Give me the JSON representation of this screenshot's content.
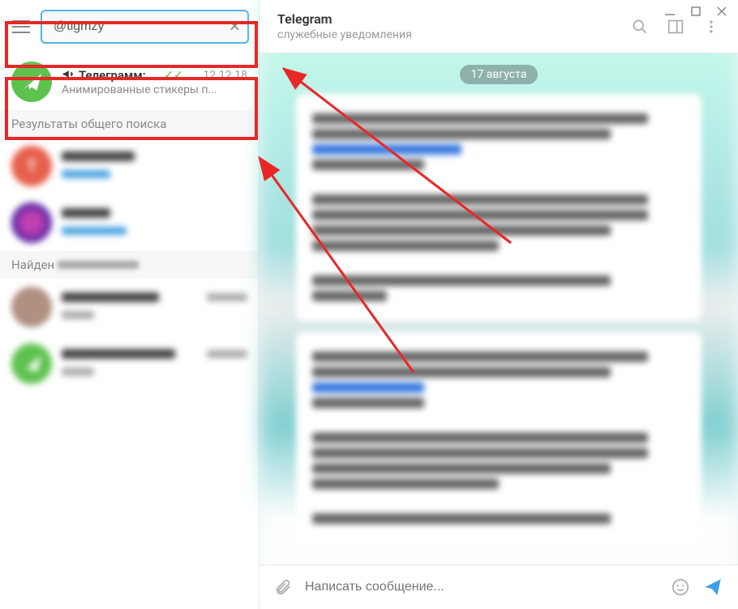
{
  "search": {
    "value": "@tlgmzy"
  },
  "pinned_chat": {
    "name": "Телеграмм: ...",
    "date": "12.12.18",
    "preview": "Анимированные стикеры п..."
  },
  "sections": {
    "global_results": "Результаты общего поиска",
    "found": "Найден"
  },
  "blur_results": {
    "r1_letter": "T"
  },
  "main": {
    "title": "Telegram",
    "subtitle": "служебные уведомления",
    "date_badge": "17 августа"
  },
  "composer": {
    "placeholder": "Написать сообщение..."
  }
}
